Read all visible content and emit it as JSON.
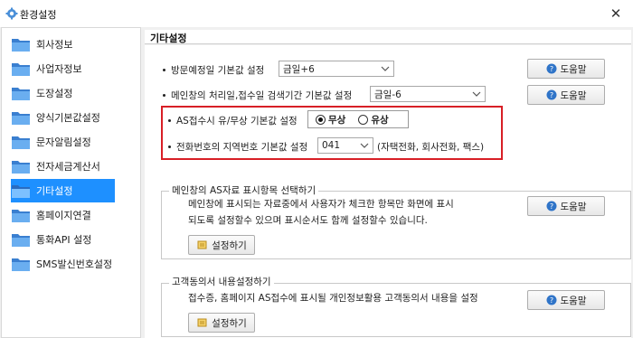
{
  "window": {
    "title": "환경설정"
  },
  "sidebar": {
    "items": [
      {
        "label": "회사정보"
      },
      {
        "label": "사업자정보"
      },
      {
        "label": "도장설정"
      },
      {
        "label": "양식기본값설정"
      },
      {
        "label": "문자알림설정"
      },
      {
        "label": "전자세금계산서"
      },
      {
        "label": "기타설정"
      },
      {
        "label": "홈페이지연결"
      },
      {
        "label": "통화API 설정"
      },
      {
        "label": "SMS발신번호설정"
      }
    ],
    "selected_index": 6
  },
  "panel": {
    "title": "기타설정",
    "rows": {
      "visit": {
        "label": "방문예정일 기본값 설정",
        "value": "금일+6"
      },
      "search": {
        "label": "메인창의 처리일,접수일 검색기간 기본값 설정",
        "value": "금일-6"
      },
      "as_paid": {
        "label": "AS접수시 유/무상 기본값 설정",
        "option_free": "무상",
        "option_paid": "유상",
        "selected": "무상"
      },
      "area_code": {
        "label": "전화번호의 지역번호 기본값 설정",
        "value": "041",
        "note": "(자택전화, 회사전화, 팩스)"
      }
    },
    "help_label": "도움말",
    "group_as": {
      "title": "메인창의 AS자료 표시항목 선택하기",
      "line1": "메인창에 표시되는 자료중에서 사용자가 체크한 항목만 화면에 표시",
      "line2": "되도록 설정할수 있으며 표시순서도 함께 설정할수 있습니다.",
      "button": "설정하기"
    },
    "group_consent": {
      "title": "고객동의서 내용설정하기",
      "line1": "접수증, 홈페이지 AS접수에 표시될 개인정보활용 고객동의서 내용을 설정",
      "button": "설정하기"
    }
  },
  "colors": {
    "selected_bg": "#1e90ff",
    "highlight_border": "#d81f26"
  }
}
